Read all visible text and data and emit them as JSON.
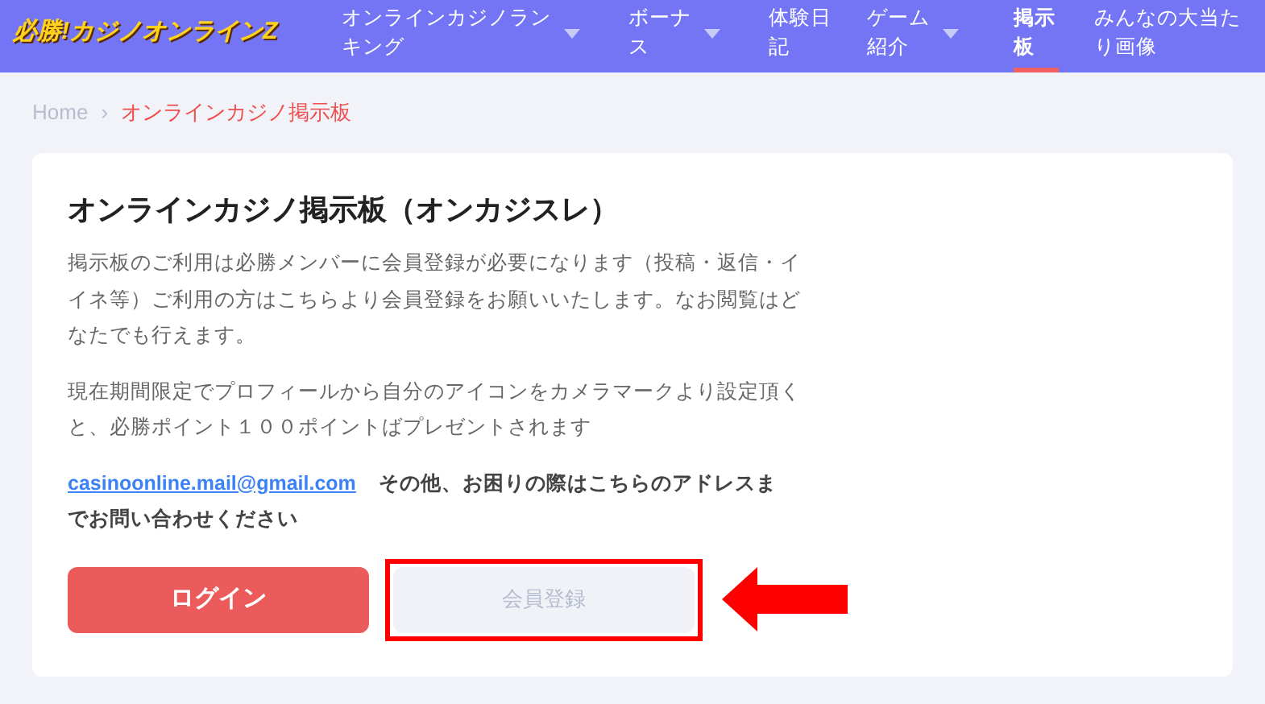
{
  "header": {
    "logo": "必勝!カジノオンラインZ",
    "nav": [
      {
        "label": "オンラインカジノランキング",
        "dropdown": true,
        "selected": false
      },
      {
        "label": "ボーナス",
        "dropdown": true,
        "selected": false
      },
      {
        "label": "体験日記",
        "dropdown": false,
        "selected": false
      },
      {
        "label": "ゲーム紹介",
        "dropdown": true,
        "selected": false
      },
      {
        "label": "掲示板",
        "dropdown": false,
        "selected": true
      },
      {
        "label": "みんなの大当たり画像",
        "dropdown": false,
        "selected": false
      }
    ]
  },
  "breadcrumb": [
    {
      "label": "Home",
      "current": false
    },
    {
      "label": "オンラインカジノ掲示板",
      "current": true
    }
  ],
  "breadcrumb_separator": "›",
  "card": {
    "title": "オンラインカジノ掲示板（オンカジスレ）",
    "paragraphs": [
      "掲示板のご利用は必勝メンバーに会員登録が必要になります（投稿・返信・イイネ等）ご利用の方はこちらより会員登録をお願いいたします。なお閲覧はどなたでも行えます。",
      "現在期間限定でプロフィールから自分のアイコンをカメラマークより設定頂くと、必勝ポイント１００ポイントばプレゼントされます"
    ],
    "email": "casinoonline.mail@gmail.com",
    "contact_note": "その他、お困りの際はこちらのアドレスまでお問い合わせください",
    "buttons": [
      {
        "label": "ログイン",
        "kind": "primary",
        "highlighted": false
      },
      {
        "label": "会員登録",
        "kind": "secondary",
        "highlighted": true
      }
    ]
  }
}
